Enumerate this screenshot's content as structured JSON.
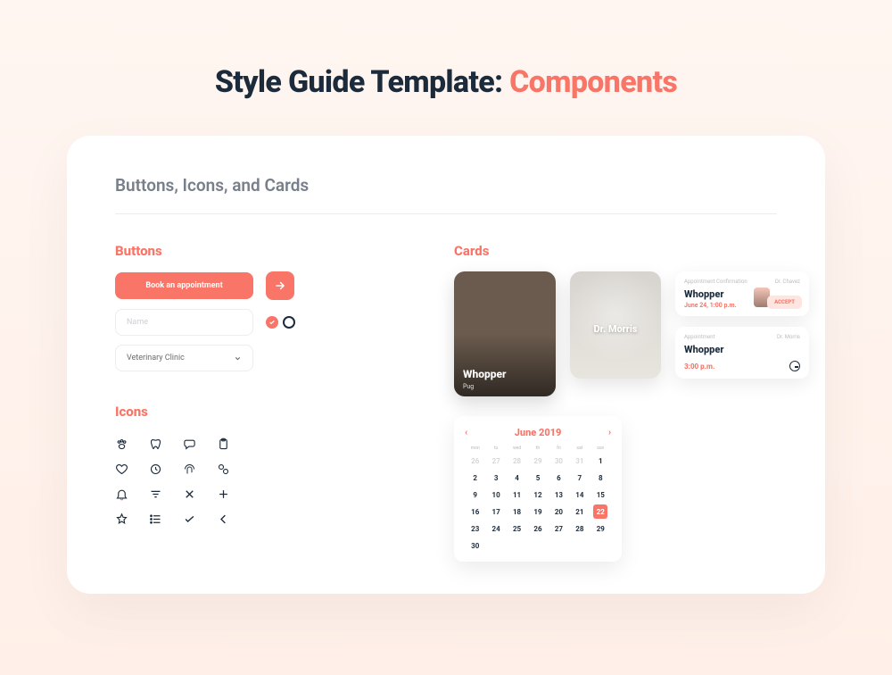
{
  "page": {
    "title_prefix": "Style Guide Template: ",
    "title_accent": "Components"
  },
  "panel": {
    "subtitle": "Buttons, Icons, and Cards"
  },
  "sections": {
    "buttons": "Buttons",
    "icons": "Icons",
    "cards": "Cards"
  },
  "buttons": {
    "primary_label": "Book an appointment",
    "name_placeholder": "Name",
    "select_value": "Veterinary Clinic"
  },
  "icons": [
    "paw",
    "tooth",
    "chat",
    "clipboard",
    "heart",
    "time",
    "fingerprint",
    "pills",
    "bell",
    "filter",
    "close",
    "plus",
    "star",
    "list",
    "check",
    "chevron-left"
  ],
  "cards": {
    "pet": {
      "name": "Whopper",
      "breed": "Pug"
    },
    "doctor": {
      "name": "Dr. Morris"
    },
    "confirmation": {
      "eyebrow": "Appointment Confirmation",
      "right_eyebrow": "Dr. Chavez",
      "title": "Whopper",
      "date": "June 24, 1:00 p.m.",
      "accept": "ACCEPT"
    },
    "appointment": {
      "eyebrow": "Appointment",
      "right_eyebrow": "Dr. Morris",
      "title": "Whopper",
      "time": "3:00 p.m."
    }
  },
  "calendar": {
    "title": "June 2019",
    "dow": [
      "mon",
      "tu",
      "wed",
      "th",
      "fri",
      "sat",
      "sun"
    ],
    "prev_tail": [
      26,
      27,
      28,
      29,
      30,
      31
    ],
    "days": [
      1,
      2,
      3,
      4,
      5,
      6,
      7,
      8,
      9,
      10,
      11,
      12,
      13,
      14,
      15,
      16,
      17,
      18,
      19,
      20,
      21,
      22,
      23,
      24,
      25,
      26,
      27,
      28,
      29,
      30
    ],
    "selected": 22
  }
}
